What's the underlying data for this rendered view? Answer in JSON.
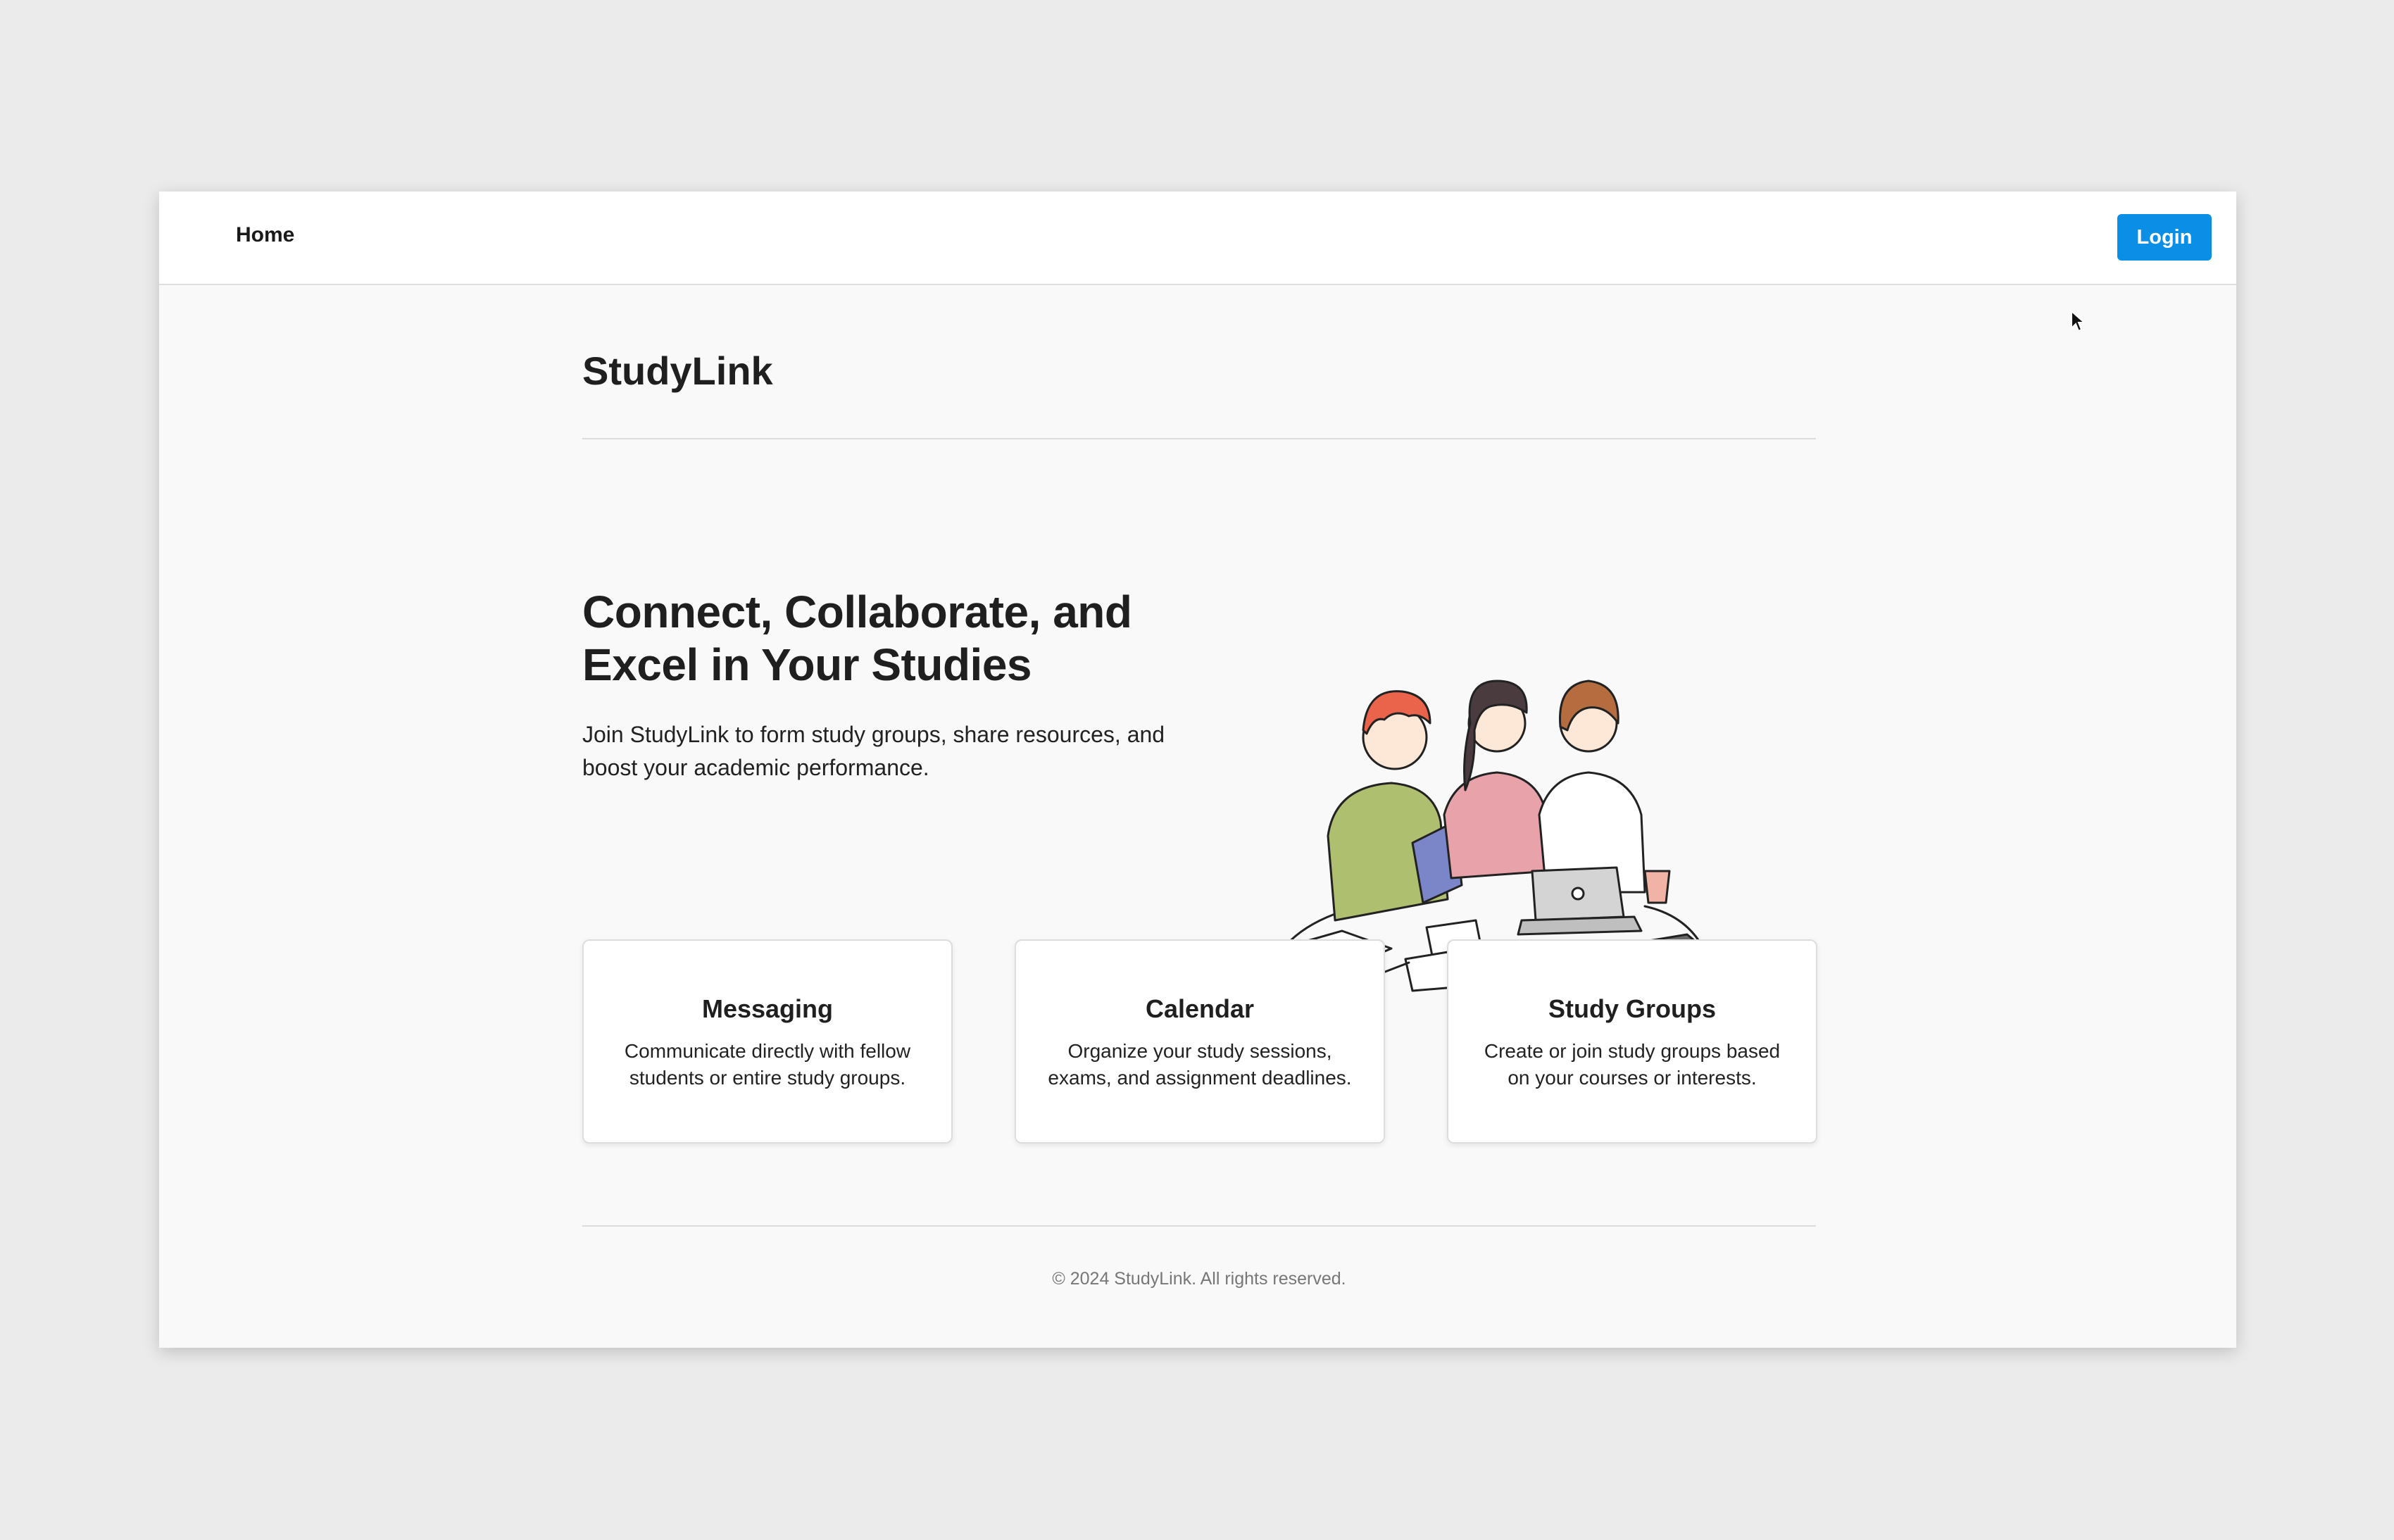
{
  "nav": {
    "home_label": "Home",
    "login_label": "Login"
  },
  "header": {
    "brand": "StudyLink"
  },
  "hero": {
    "title": "Connect, Collaborate, and Excel in Your Studies",
    "description": "Join StudyLink to form study groups, share resources, and boost your academic performance.",
    "illustration_icon": "students-studying-illustration"
  },
  "features": [
    {
      "title": "Messaging",
      "description": "Communicate directly with fellow students or entire study groups."
    },
    {
      "title": "Calendar",
      "description": "Organize your study sessions, exams, and assignment deadlines."
    },
    {
      "title": "Study Groups",
      "description": "Create or join study groups based on your courses or interests."
    }
  ],
  "footer": {
    "text": "© 2024 StudyLink. All rights reserved."
  },
  "colors": {
    "accent": "#0a8ee6",
    "background": "#ebebeb",
    "page": "#f9f9f9"
  }
}
